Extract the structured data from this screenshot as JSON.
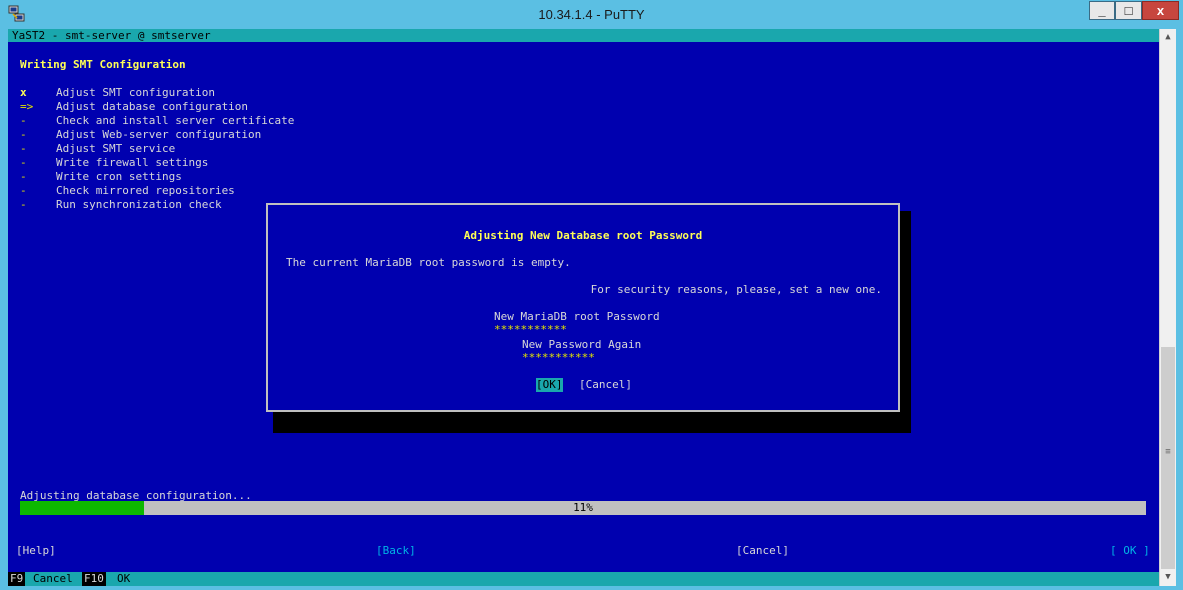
{
  "window": {
    "title": "10.34.1.4 - PuTTY",
    "min_glyph": "_",
    "max_glyph": "□",
    "close_glyph": "x"
  },
  "terminal": {
    "header": "YaST2 - smt-server @ smtserver",
    "section_title": "Writing SMT Configuration",
    "steps": [
      {
        "mark": "x",
        "label": "Adjust SMT configuration"
      },
      {
        "mark": "=>",
        "label": "Adjust database configuration"
      },
      {
        "mark": "-",
        "label": "Check and install server certificate"
      },
      {
        "mark": "-",
        "label": "Adjust Web-server configuration"
      },
      {
        "mark": "-",
        "label": "Adjust SMT service"
      },
      {
        "mark": "-",
        "label": "Write firewall settings"
      },
      {
        "mark": "-",
        "label": "Write cron settings"
      },
      {
        "mark": "-",
        "label": "Check mirrored repositories"
      },
      {
        "mark": "-",
        "label": "Run synchronization check"
      }
    ],
    "dialog": {
      "title": "Adjusting New Database root Password",
      "line1": "The current MariaDB root password is empty.",
      "line2": "For security reasons, please, set a new one.",
      "password_label": "New MariaDB root Password",
      "password_value": "***********",
      "password_again_label": "New Password Again",
      "password_again_value": "***********",
      "ok_label": "[OK]",
      "cancel_label": "[Cancel]"
    },
    "progress": {
      "label": "Adjusting database configuration...",
      "percent_text": "11%",
      "fraction": 0.11
    },
    "buttons": {
      "help": "[Help]",
      "back": "[Back]",
      "cancel": "[Cancel]",
      "ok": "[ OK ]"
    },
    "fkeys": [
      {
        "key": "F9",
        "label": "Cancel"
      },
      {
        "key": "F10",
        "label": "OK"
      }
    ]
  },
  "colors": {
    "background": "#0000af",
    "accent": "#1aa7ad",
    "progress_fill": "#0db800",
    "highlight_text": "#e2e200"
  }
}
